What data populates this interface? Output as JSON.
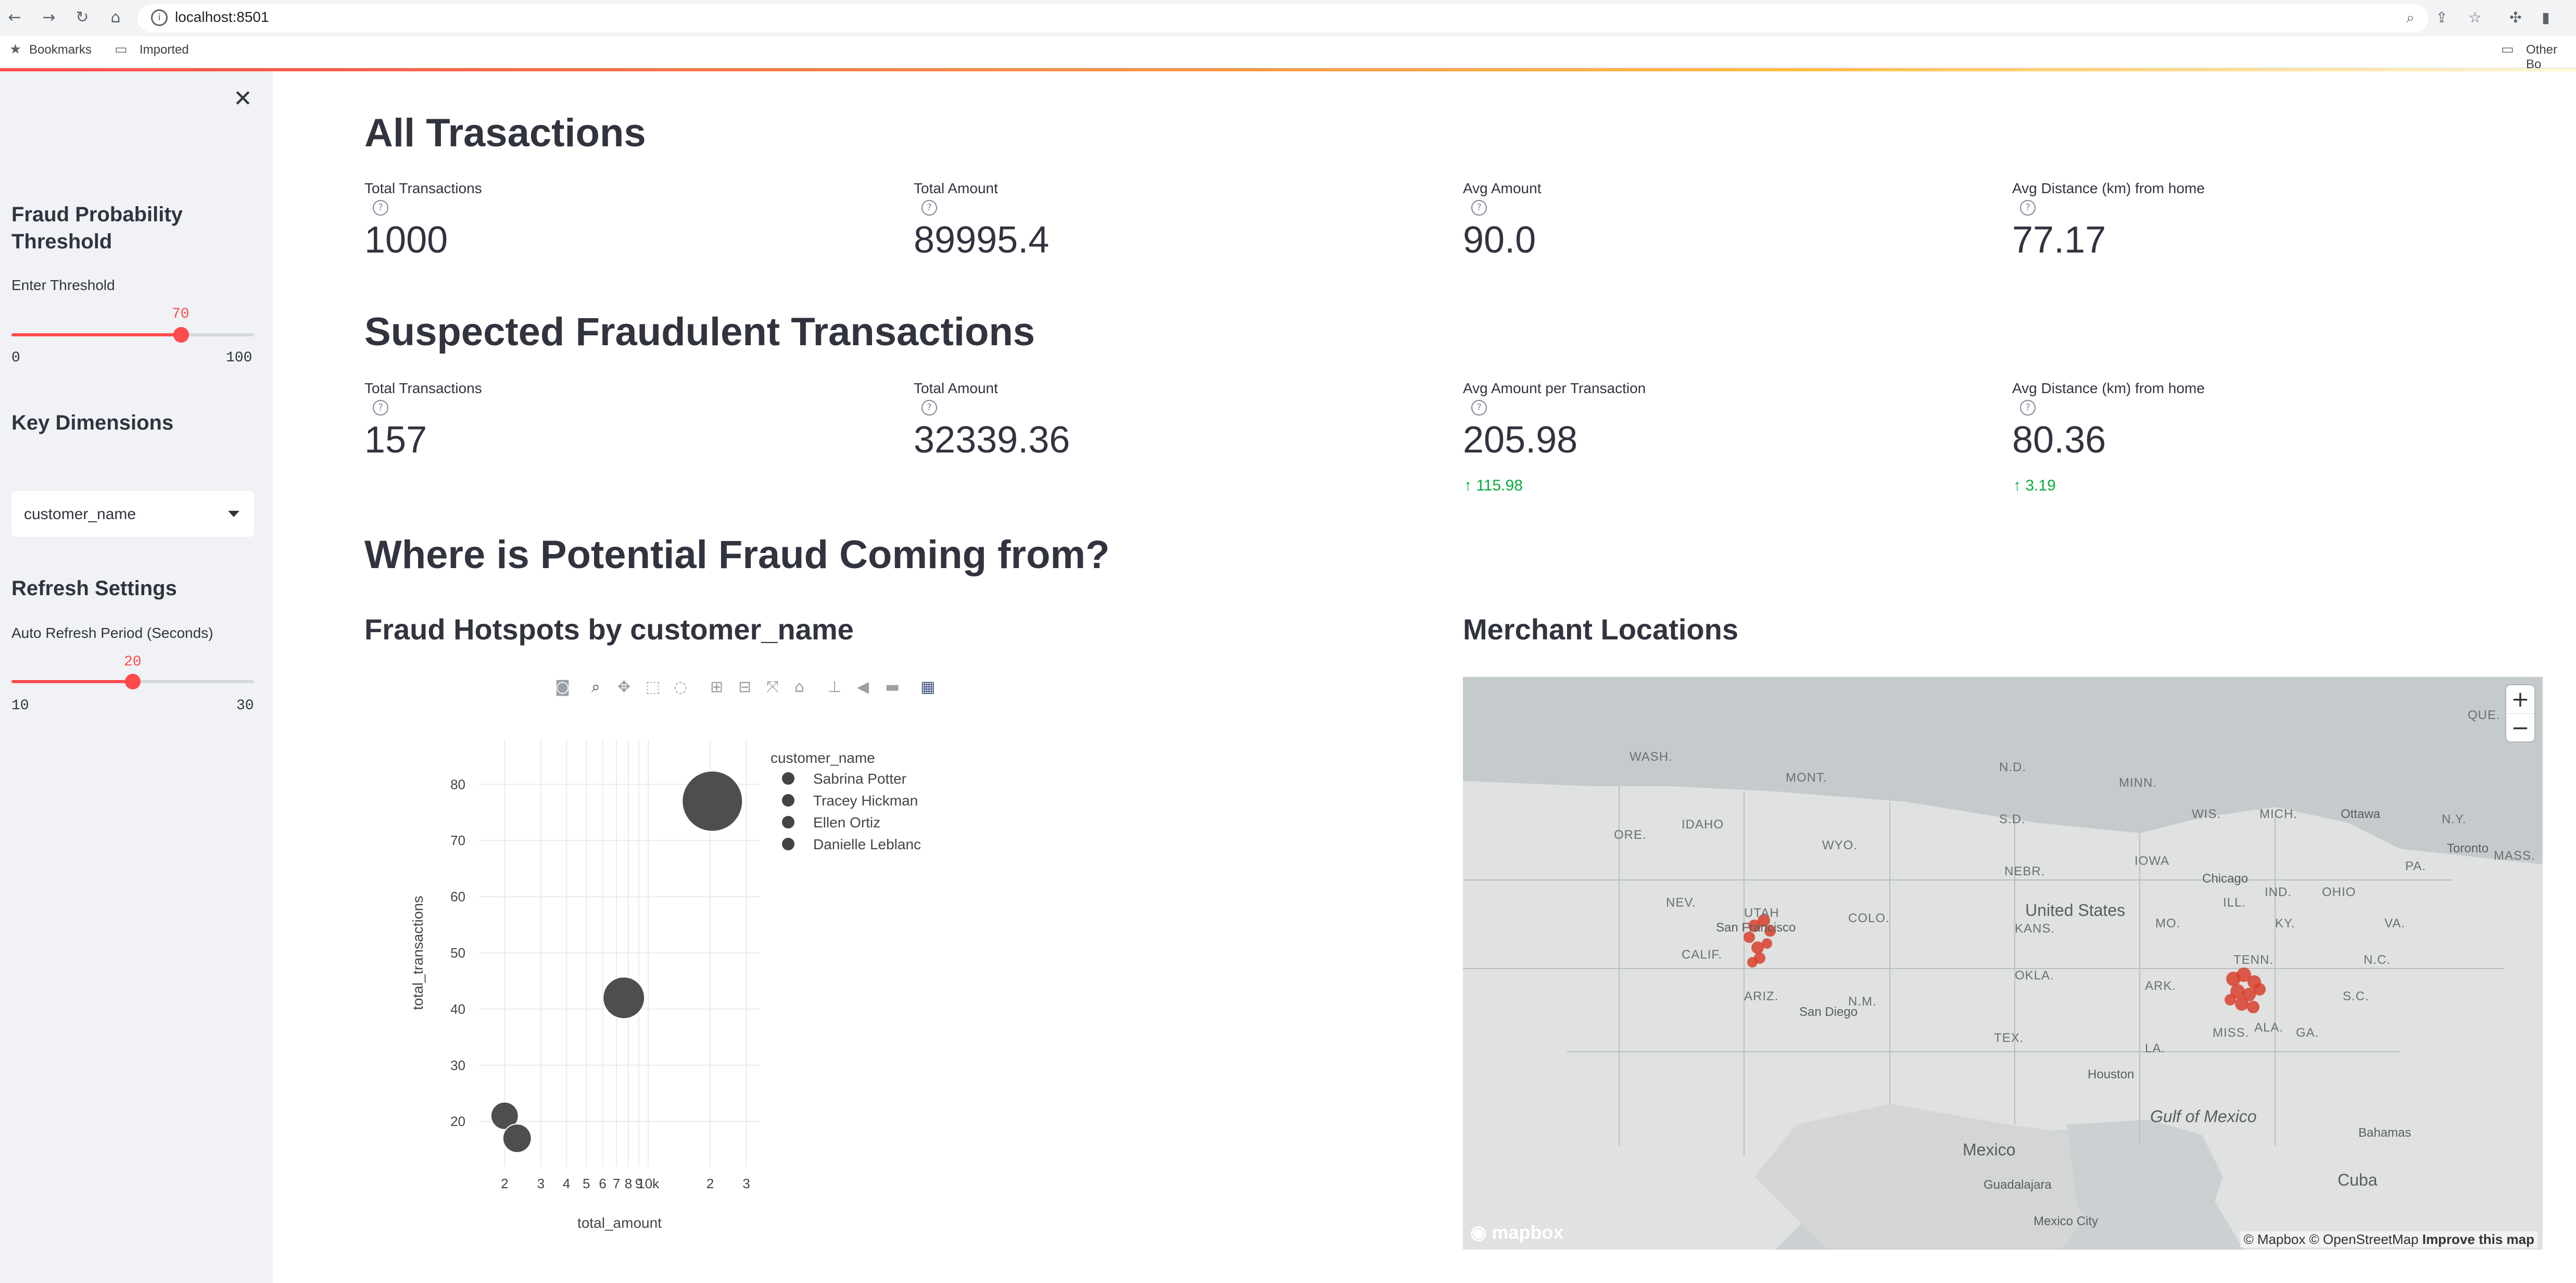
{
  "browser": {
    "url": "localhost:8501",
    "bookmarks": [
      {
        "label": "Bookmarks"
      },
      {
        "label": "Imported"
      }
    ],
    "other_bookmarks": "Other Bo"
  },
  "sidebar": {
    "threshold_section": {
      "title": "Fraud Probability Threshold",
      "label": "Enter Threshold",
      "value": "70",
      "min": "0",
      "max": "100",
      "level": 0.7
    },
    "dimension_section": {
      "title": "Key Dimensions",
      "selected": "customer_name"
    },
    "refresh_section": {
      "title": "Refresh Settings",
      "label": "Auto Refresh Period (Seconds)",
      "value": "20",
      "min": "10",
      "max": "30",
      "level": 0.5
    }
  },
  "all_transactions": {
    "title": "All Trasactions",
    "metrics": [
      {
        "label": "Total Transactions",
        "value": "1000"
      },
      {
        "label": "Total Amount",
        "value": "89995.4"
      },
      {
        "label": "Avg Amount",
        "value": "90.0"
      },
      {
        "label": "Avg Distance (km) from home",
        "value": "77.17"
      }
    ]
  },
  "fraud_transactions": {
    "title": "Suspected Fraudulent Transactions",
    "metrics": [
      {
        "label": "Total Transactions",
        "value": "157",
        "delta": ""
      },
      {
        "label": "Total Amount",
        "value": "32339.36",
        "delta": ""
      },
      {
        "label": "Avg Amount per Transaction",
        "value": "205.98",
        "delta": "115.98"
      },
      {
        "label": "Avg Distance (km) from home",
        "value": "80.36",
        "delta": "3.19"
      }
    ]
  },
  "where_title": "Where is Potential Fraud Coming from?",
  "hotspots": {
    "title": "Fraud Hotspots by customer_name",
    "legend_title": "customer_name"
  },
  "chart_data": {
    "type": "scatter",
    "xlabel": "total_amount",
    "ylabel": "total_transactions",
    "x_scale": "log",
    "xlim": [
      1500,
      35000
    ],
    "ylim": [
      12,
      88
    ],
    "x_ticks": [
      {
        "v": 2000,
        "label": "2"
      },
      {
        "v": 3000,
        "label": "3"
      },
      {
        "v": 4000,
        "label": "4"
      },
      {
        "v": 5000,
        "label": "5"
      },
      {
        "v": 6000,
        "label": "6"
      },
      {
        "v": 7000,
        "label": "7"
      },
      {
        "v": 8000,
        "label": "8"
      },
      {
        "v": 9000,
        "label": "9"
      },
      {
        "v": 10000,
        "label": "10k"
      },
      {
        "v": 20000,
        "label": "2"
      },
      {
        "v": 30000,
        "label": "3"
      }
    ],
    "y_ticks": [
      20,
      30,
      40,
      50,
      60,
      70,
      80
    ],
    "series": [
      {
        "name": "Sabrina Potter",
        "x": 20500,
        "y": 77,
        "size": 20500
      },
      {
        "name": "Tracey Hickman",
        "x": 7600,
        "y": 42,
        "size": 7600
      },
      {
        "name": "Ellen Ortiz",
        "x": 2000,
        "y": 21,
        "size": 2000
      },
      {
        "name": "Danielle Leblanc",
        "x": 2300,
        "y": 17,
        "size": 2300
      }
    ],
    "color": "#444444"
  },
  "merchants": {
    "title": "Merchant Locations",
    "attribution_map": "© Mapbox © OpenStreetMap",
    "attribution_improve": "Improve this map",
    "logo": "mapbox",
    "labels": {
      "country": "United States",
      "gulf": "Gulf of Mexico",
      "mexico": "Mexico",
      "cuba": "Cuba",
      "bahamas": "Bahamas",
      "chicago": "Chicago",
      "houston": "Houston",
      "san_diego": "San Diego",
      "san_francisco": "San Francisco",
      "toronto": "Toronto",
      "ottawa": "Ottawa",
      "guadalajara": "Guadalajara",
      "mexico_city": "Mexico City",
      "states": [
        "WASH.",
        "ORE.",
        "IDAHO",
        "MONT.",
        "WYO.",
        "NEV.",
        "UTAH",
        "COLO.",
        "ARIZ.",
        "N.M.",
        "TEX.",
        "OKLA.",
        "KANS.",
        "NEBR.",
        "S.D.",
        "N.D.",
        "MINN.",
        "IOWA",
        "MO.",
        "ARK.",
        "LA.",
        "MISS.",
        "ALA.",
        "GA.",
        "TENN.",
        "S.C.",
        "N.C.",
        "VA.",
        "KY.",
        "OHIO",
        "IND.",
        "ILL.",
        "WIS.",
        "MICH.",
        "PA.",
        "N.Y.",
        "CALIF.",
        "QUE.",
        "MASS."
      ]
    },
    "marker_color": "#d9402b"
  }
}
